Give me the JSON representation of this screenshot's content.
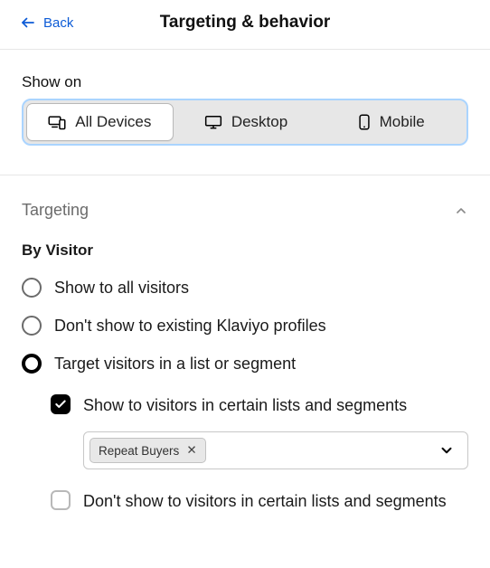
{
  "header": {
    "back_label": "Back",
    "title": "Targeting & behavior"
  },
  "show_on": {
    "label": "Show on",
    "options": [
      {
        "icon": "devices-icon",
        "label": "All Devices",
        "selected": true
      },
      {
        "icon": "desktop-icon",
        "label": "Desktop",
        "selected": false
      },
      {
        "icon": "mobile-icon",
        "label": "Mobile",
        "selected": false
      }
    ]
  },
  "targeting": {
    "section_title": "Targeting",
    "expanded": true,
    "by_visitor": {
      "label": "By Visitor",
      "options": [
        {
          "label": "Show to all visitors",
          "selected": false
        },
        {
          "label": "Don't show to existing Klaviyo profiles",
          "selected": false
        },
        {
          "label": "Target visitors in a list or segment",
          "selected": true
        }
      ],
      "nested": {
        "show": {
          "label": "Show to visitors in certain lists and segments",
          "checked": true,
          "selected_tags": [
            "Repeat Buyers"
          ]
        },
        "dont_show": {
          "label": "Don't show to visitors in certain lists and segments",
          "checked": false
        }
      }
    }
  }
}
